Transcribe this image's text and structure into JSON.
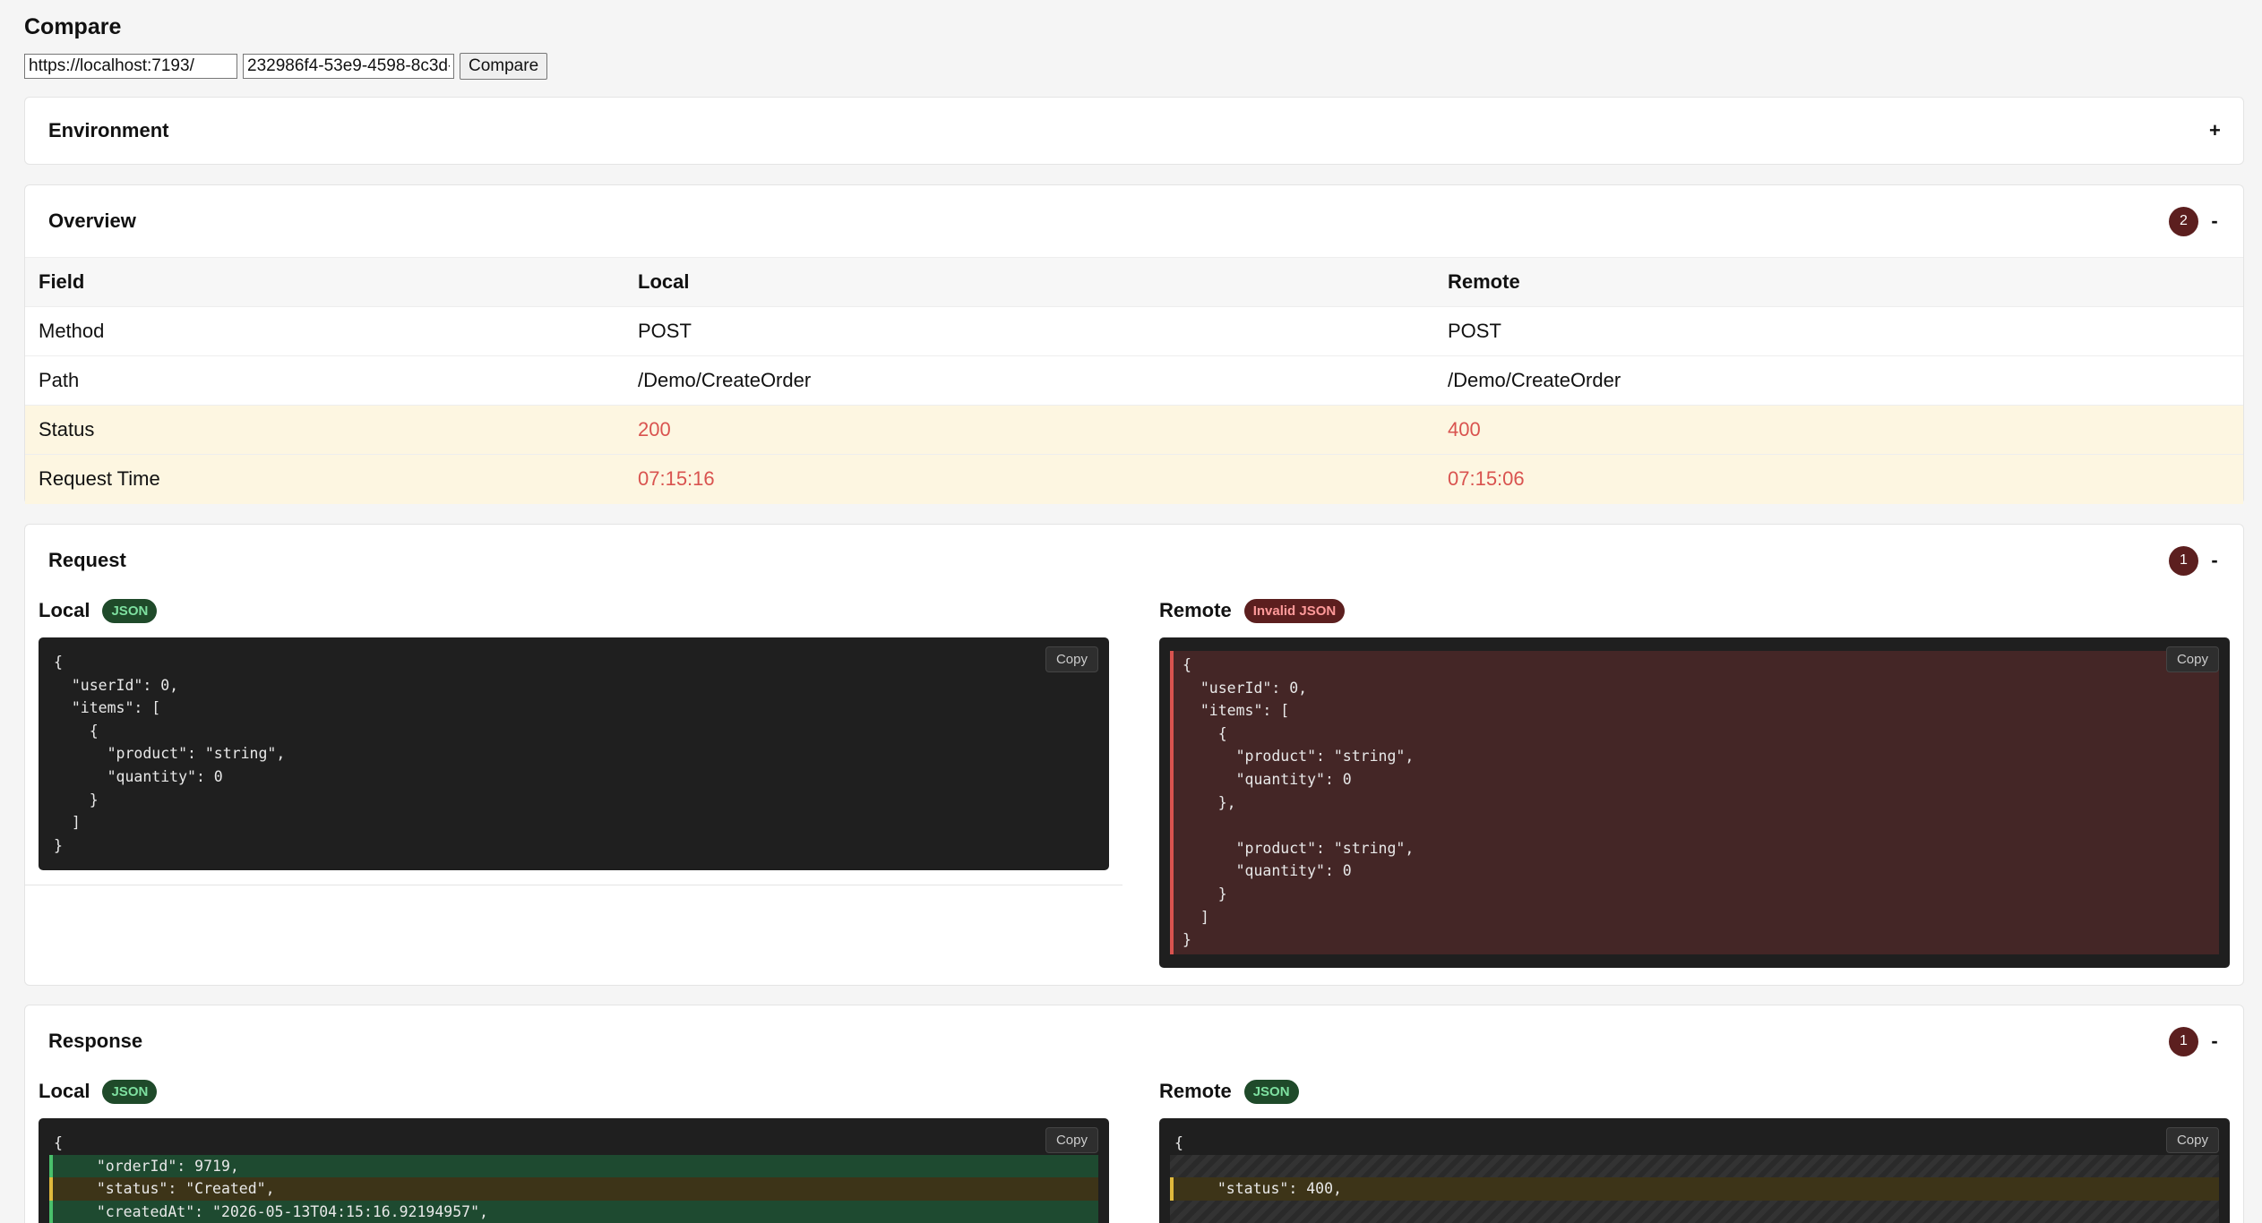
{
  "title": "Compare",
  "controls": {
    "url_value": "https://localhost:7193/",
    "id_value": "232986f4-53e9-4598-8c3d-",
    "compare_label": "Compare"
  },
  "environment": {
    "title": "Environment",
    "toggle": "+"
  },
  "overview": {
    "title": "Overview",
    "count": "2",
    "toggle": "-",
    "headers": [
      "Field",
      "Local",
      "Remote"
    ],
    "rows": [
      {
        "field": "Method",
        "local": "POST",
        "remote": "POST"
      },
      {
        "field": "Path",
        "local": "/Demo/CreateOrder",
        "remote": "/Demo/CreateOrder"
      },
      {
        "field": "Status",
        "local": "200",
        "remote": "400"
      },
      {
        "field": "Request Time",
        "local": "07:15:16",
        "remote": "07:15:06"
      }
    ]
  },
  "request": {
    "title": "Request",
    "count": "1",
    "toggle": "-",
    "local": {
      "label": "Local",
      "badge": "JSON",
      "copy": "Copy",
      "lines": [
        "{",
        "  \"userId\": 0,",
        "  \"items\": [",
        "    {",
        "      \"product\": \"string\",",
        "      \"quantity\": 0",
        "    }",
        "  ]",
        "}"
      ]
    },
    "remote": {
      "label": "Remote",
      "badge": "Invalid JSON",
      "copy": "Copy",
      "lines": [
        "{",
        "  \"userId\": 0,",
        "  \"items\": [",
        "    {",
        "      \"product\": \"string\",",
        "      \"quantity\": 0",
        "    },",
        "",
        "      \"product\": \"string\",",
        "      \"quantity\": 0",
        "    }",
        "  ]",
        "}"
      ]
    }
  },
  "response": {
    "title": "Response",
    "count": "1",
    "toggle": "-",
    "local": {
      "label": "Local",
      "badge": "JSON",
      "copy": "Copy",
      "lines": [
        "{",
        "  \"orderId\": 9719,",
        "  \"status\": \"Created\",",
        "  \"createdAt\": \"2026-05-13T04:15:16.92194957\","
      ]
    },
    "remote": {
      "label": "Remote",
      "badge": "JSON",
      "copy": "Copy",
      "lines": [
        "{",
        "",
        "  \"status\": 400,",
        ""
      ]
    }
  }
}
